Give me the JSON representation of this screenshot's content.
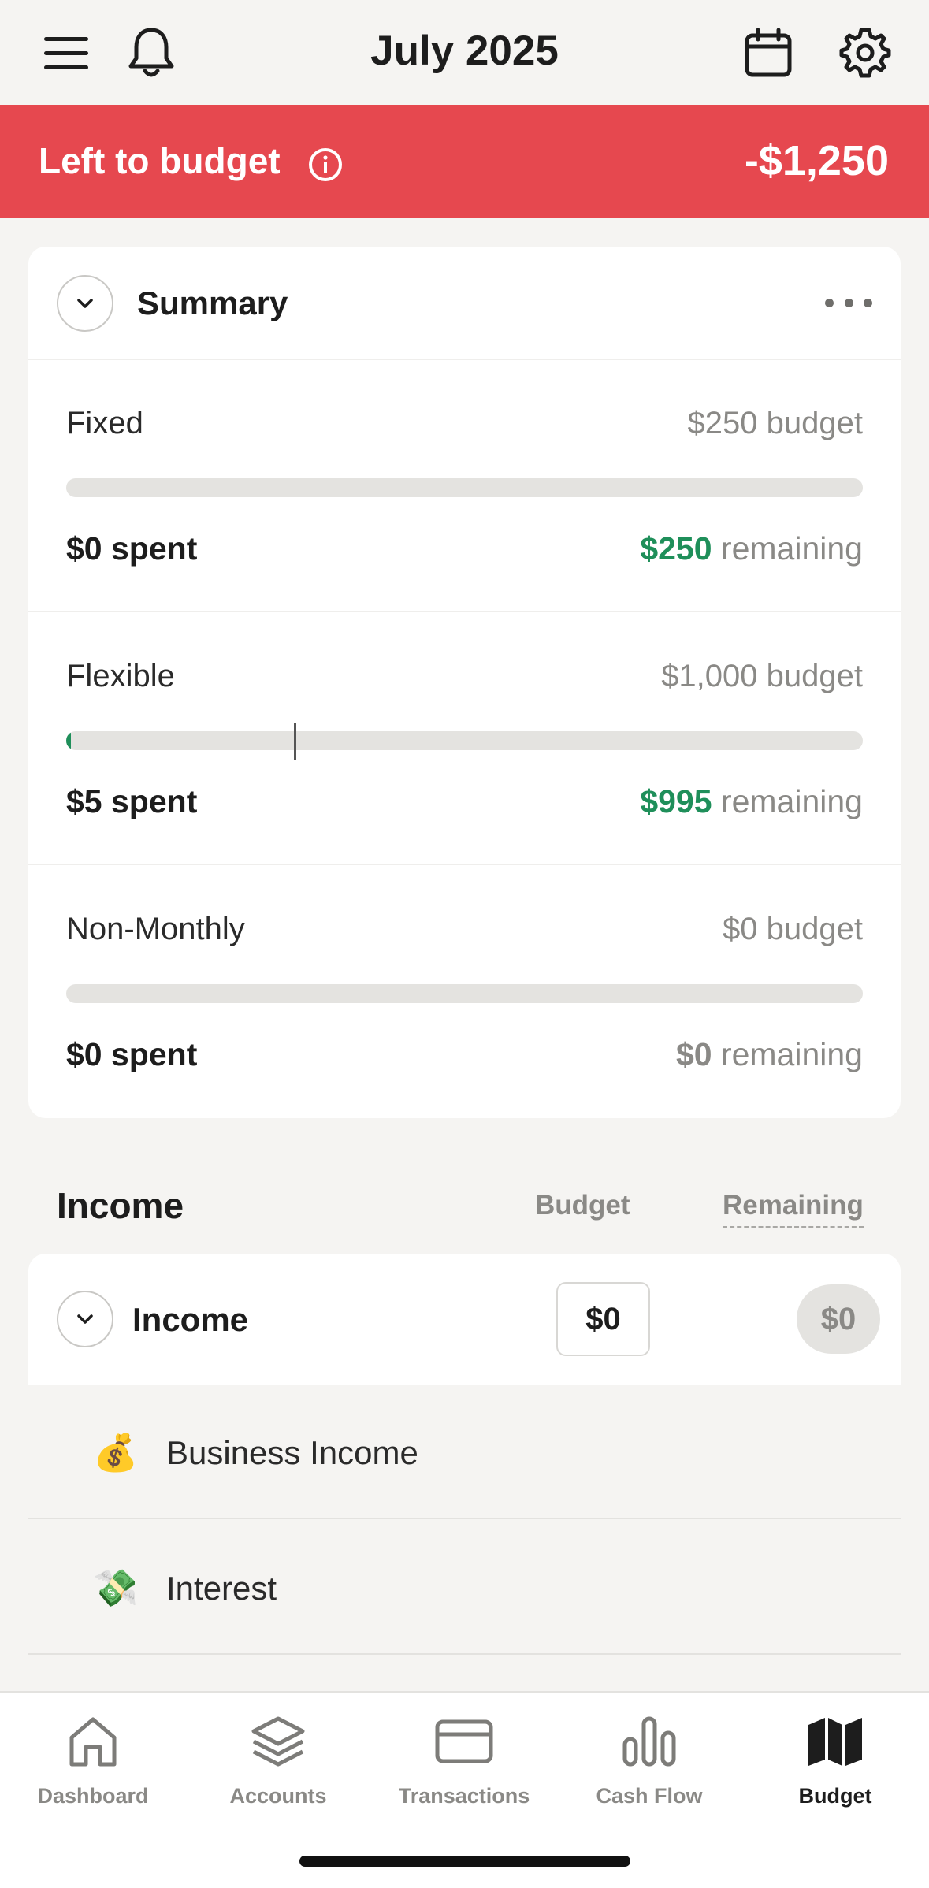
{
  "header": {
    "title": "July 2025",
    "menu_icon": "hamburger-menu-icon",
    "bell_icon": "bell-icon",
    "calendar_icon": "calendar-icon",
    "settings_icon": "gear-icon"
  },
  "banner": {
    "label": "Left to budget",
    "amount": "-$1,250",
    "color": "#e6484f"
  },
  "summary": {
    "title": "Summary",
    "sections": [
      {
        "name": "Fixed",
        "budget": "$250 budget",
        "spent": "$0 spent",
        "remaining_amount": "$250",
        "remaining_label": "remaining",
        "progress": 0
      },
      {
        "name": "Flexible",
        "budget": "$1,000 budget",
        "spent": "$5 spent",
        "remaining_amount": "$995",
        "remaining_label": "remaining",
        "progress": 0.005
      },
      {
        "name": "Non-Monthly",
        "budget": "$0 budget",
        "spent": "$0 spent",
        "remaining_amount": "$0",
        "remaining_label": "remaining",
        "progress": 0
      }
    ]
  },
  "income": {
    "title": "Income",
    "col_budget": "Budget",
    "col_remaining": "Remaining",
    "group": {
      "title": "Income",
      "budget": "$0",
      "remaining": "$0"
    },
    "rows": [
      {
        "emoji": "💰",
        "label": "Business Income"
      },
      {
        "emoji": "💸",
        "label": "Interest"
      }
    ]
  },
  "nav": {
    "items": [
      {
        "label": "Dashboard",
        "icon": "home-icon"
      },
      {
        "label": "Accounts",
        "icon": "layers-icon"
      },
      {
        "label": "Transactions",
        "icon": "credit-card-icon"
      },
      {
        "label": "Cash Flow",
        "icon": "bar-chart-icon"
      },
      {
        "label": "Budget",
        "icon": "map-icon",
        "active": true
      }
    ]
  },
  "colors": {
    "accent_green": "#1f8f5a",
    "banner_red": "#e6484f",
    "muted_text": "#8a8986"
  }
}
